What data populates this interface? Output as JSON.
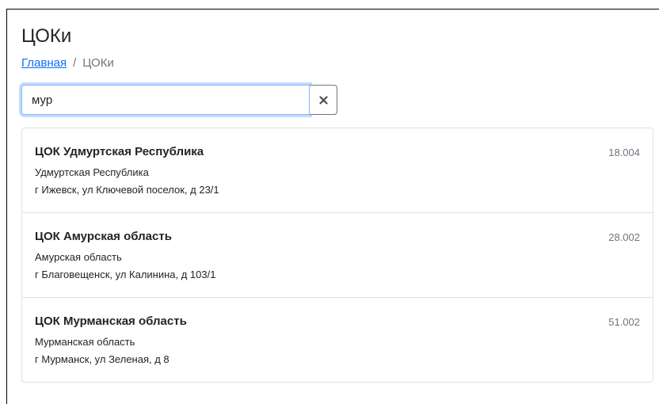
{
  "page": {
    "title": "ЦОКи"
  },
  "breadcrumb": {
    "home_label": "Главная",
    "separator": "/",
    "current_label": "ЦОКи"
  },
  "search": {
    "value": "мур",
    "clear_icon": "close-icon"
  },
  "colors": {
    "link": "#0d6efd",
    "focus_border": "#86b7fe",
    "muted": "#6c757d",
    "border": "#dee2e6"
  },
  "results": [
    {
      "title": "ЦОК Удмуртская Республика",
      "code": "18.004",
      "region": "Удмуртская Республика",
      "address": "г Ижевск, ул Ключевой поселок, д 23/1"
    },
    {
      "title": "ЦОК Амурская область",
      "code": "28.002",
      "region": "Амурская область",
      "address": "г Благовещенск, ул Калинина, д 103/1"
    },
    {
      "title": "ЦОК Мурманская область",
      "code": "51.002",
      "region": "Мурманская область",
      "address": "г Мурманск, ул Зеленая, д 8"
    }
  ]
}
